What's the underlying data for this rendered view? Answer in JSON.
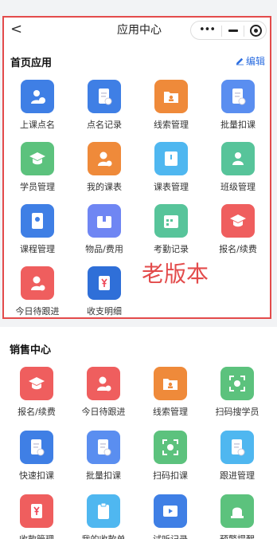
{
  "navbar": {
    "back": "<",
    "title": "应用中心",
    "capsule_dots": "•••"
  },
  "home_apps": {
    "title": "首页应用",
    "edit_label": "编辑",
    "items": [
      {
        "label": "上课点名",
        "icon": "person-check-icon",
        "color": "#3f7fe5"
      },
      {
        "label": "点名记录",
        "icon": "doc-check-icon",
        "color": "#3f7fe5"
      },
      {
        "label": "线索管理",
        "icon": "folder-person-icon",
        "color": "#ef8a3a"
      },
      {
        "label": "批量扣课",
        "icon": "doc-minus-icon",
        "color": "#5a8ef0"
      },
      {
        "label": "学员管理",
        "icon": "student-icon",
        "color": "#5cc27d"
      },
      {
        "label": "我的课表",
        "icon": "teacher-icon",
        "color": "#ef8a3a"
      },
      {
        "label": "课表管理",
        "icon": "book-icon",
        "color": "#4fb7f0"
      },
      {
        "label": "班级管理",
        "icon": "group-icon",
        "color": "#57c49a"
      },
      {
        "label": "课程管理",
        "icon": "course-book-icon",
        "color": "#3f7fe5"
      },
      {
        "label": "物品/费用",
        "icon": "box-icon",
        "color": "#6f86f3"
      },
      {
        "label": "考勤记录",
        "icon": "calendar-icon",
        "color": "#57c49a"
      },
      {
        "label": "报名/续费",
        "icon": "grad-cap-icon",
        "color": "#ef5e5e"
      },
      {
        "label": "今日待跟进",
        "icon": "person-clock-icon",
        "color": "#ef5e5e"
      },
      {
        "label": "收支明细",
        "icon": "ledger-yen-icon",
        "color": "#2f6fd8"
      }
    ]
  },
  "old_version_label": "老版本",
  "sales_center": {
    "title": "销售中心",
    "items": [
      {
        "label": "报名/续费",
        "icon": "grad-cap-icon",
        "color": "#ef5e5e"
      },
      {
        "label": "今日待跟进",
        "icon": "person-clock-icon",
        "color": "#ef5e5e"
      },
      {
        "label": "线索管理",
        "icon": "folder-person-icon",
        "color": "#ef8a3a"
      },
      {
        "label": "扫码搜学员",
        "icon": "scan-search-icon",
        "color": "#5cc27d"
      },
      {
        "label": "快速扣课",
        "icon": "doc-fast-icon",
        "color": "#3f7fe5"
      },
      {
        "label": "批量扣课",
        "icon": "doc-minus-icon",
        "color": "#5a8ef0"
      },
      {
        "label": "扫码扣课",
        "icon": "scan-minus-icon",
        "color": "#5cc27d"
      },
      {
        "label": "跟进管理",
        "icon": "doc-follow-icon",
        "color": "#4fb7f0"
      },
      {
        "label": "收款管理",
        "icon": "yen-receipt-icon",
        "color": "#ef5e5e"
      },
      {
        "label": "我的收款单",
        "icon": "clipboard-icon",
        "color": "#4fb7f0"
      },
      {
        "label": "试听记录",
        "icon": "video-icon",
        "color": "#3f7fe5"
      },
      {
        "label": "预警提醒",
        "icon": "alarm-icon",
        "color": "#5cc27d"
      }
    ]
  }
}
